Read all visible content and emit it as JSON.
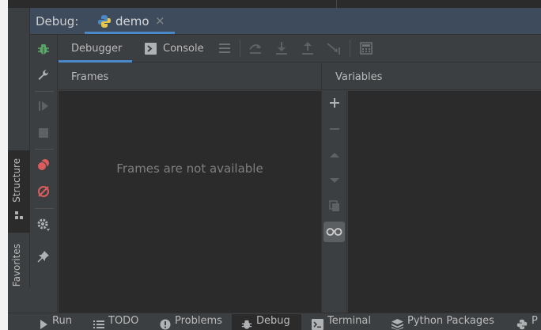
{
  "header": {
    "title": "Debug:",
    "session_tab": {
      "label": "demo",
      "close": "×"
    }
  },
  "side_tabs": [
    {
      "label": "Structure"
    },
    {
      "label": "Favorites"
    }
  ],
  "tabs": [
    {
      "label": "Debugger",
      "active": true
    },
    {
      "label": "Console",
      "active": false
    }
  ],
  "panels": {
    "frames": {
      "title": "Frames",
      "empty_text": "Frames are not available"
    },
    "variables": {
      "title": "Variables"
    }
  },
  "bottom_bar": [
    {
      "label": "Run",
      "icon": "run-icon"
    },
    {
      "label": "TODO",
      "icon": "list-icon"
    },
    {
      "label": "Problems",
      "icon": "problems-icon"
    },
    {
      "label": "Debug",
      "icon": "bug-icon",
      "active": true
    },
    {
      "label": "Terminal",
      "icon": "terminal-icon"
    },
    {
      "label": "Python Packages",
      "icon": "packages-icon"
    },
    {
      "label": "P",
      "icon": "python-icon"
    }
  ],
  "colors": {
    "accent": "#4a88c7",
    "header_bg": "#3d4b5c",
    "panel_bg": "#2b2b2b",
    "toolbar_bg": "#3c3f41",
    "bug_green": "#59a869",
    "breakpoint_red": "#db5c5c"
  }
}
